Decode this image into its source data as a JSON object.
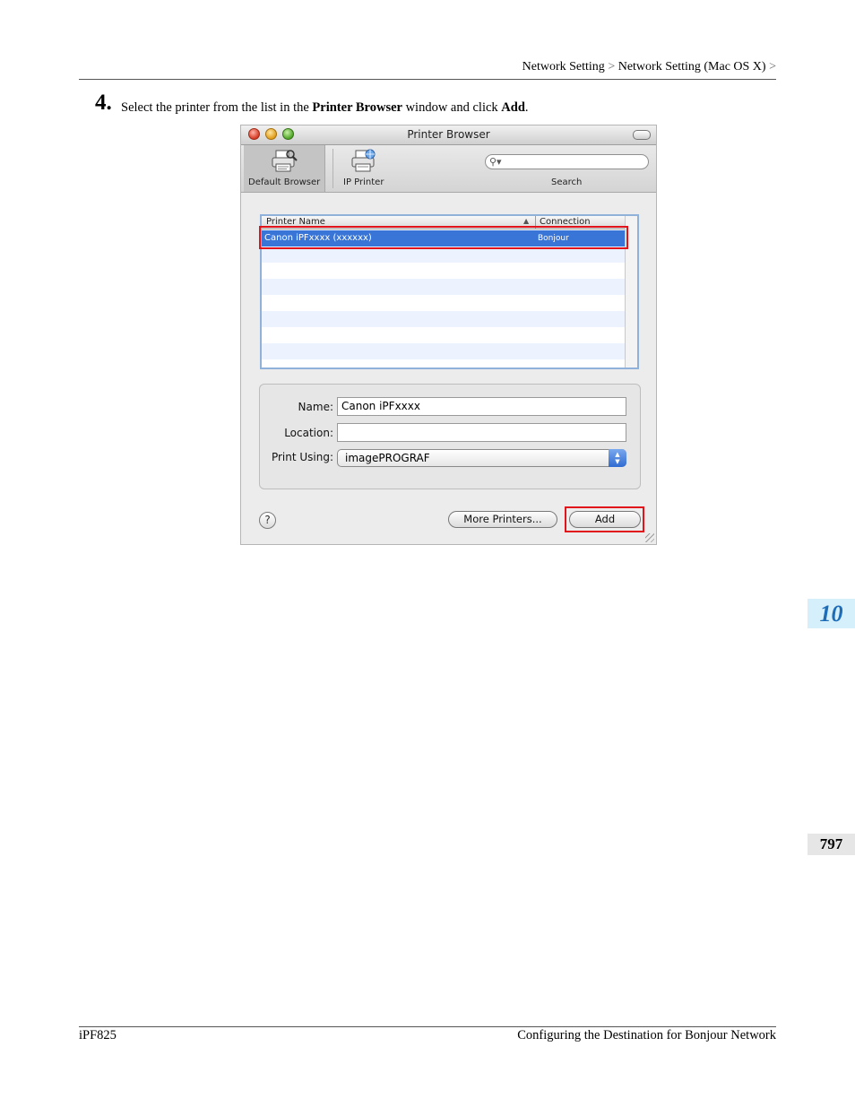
{
  "header": {
    "breadcrumb": [
      "Network Setting",
      "Network Setting (Mac OS X)"
    ],
    "separator": ">"
  },
  "step": {
    "number": "4.",
    "text_before": "Select the printer from the list in the ",
    "bold1": "Printer Browser",
    "text_middle": " window and click ",
    "bold2": "Add",
    "text_after": "."
  },
  "window": {
    "title": "Printer Browser",
    "toolbar": {
      "default_browser": "Default Browser",
      "ip_printer": "IP Printer",
      "search": "Search"
    },
    "list": {
      "col_name": "Printer Name",
      "col_connection": "Connection",
      "sort_arrow": "▲",
      "rows": [
        {
          "name": "Canon iPFxxxx (xxxxxx)",
          "connection": "Bonjour",
          "selected": true
        }
      ]
    },
    "form": {
      "name_label": "Name:",
      "name_value": "Canon iPFxxxx",
      "location_label": "Location:",
      "location_value": "",
      "print_using_label": "Print Using:",
      "print_using_value": "imagePROGRAF"
    },
    "buttons": {
      "help": "?",
      "more_printers": "More Printers...",
      "add": "Add"
    }
  },
  "side_tabs": {
    "chapter": "10",
    "page": "797"
  },
  "footer": {
    "left": "iPF825",
    "right": "Configuring the Destination for Bonjour Network"
  },
  "colors": {
    "highlight_red": "#e1141c",
    "selection_blue": "#3875d7",
    "chapter_tab_bg": "#d6f0fb",
    "chapter_tab_text": "#1d6cb8"
  }
}
